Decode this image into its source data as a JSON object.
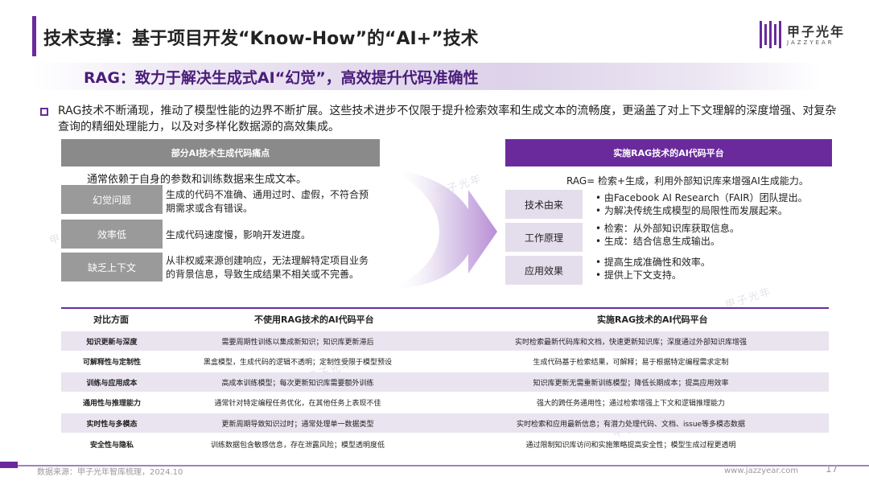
{
  "title": "技术支撑：基于项目开发“Know-How”的“AI+”技术",
  "subtitle": "RAG：致力于解决生成式AI“幻觉”，高效提升代码准确性",
  "logo": {
    "cn": "甲子光年",
    "en": "JAZZYEAR",
    "color": "#6a2a9c"
  },
  "intro": "RAG技术不断涌现，推动了模型性能的边界不断扩展。这些技术进步不仅限于提升检索效率和生成文本的流畅度，更涵盖了对上下文理解的深度增强、对复杂查询的精细处理能力，以及对多样化数据源的高效集成。",
  "left": {
    "header": "部分AI技术生成代码痛点",
    "subtitle": "通常依赖于自身的参数和训练数据来生成文本。",
    "items": [
      {
        "label": "幻觉问题",
        "desc": "生成的代码不准确、通用过时、虚假，不符合预期需求或含有错误。"
      },
      {
        "label": "效率低",
        "desc": "生成代码速度慢，影响开发进度。"
      },
      {
        "label": "缺乏上下文",
        "desc": "从非权威来源创建响应，无法理解特定项目业务的背景信息，导致生成结果不相关或不完善。"
      }
    ]
  },
  "right": {
    "header": "实施RAG技术的AI代码平台",
    "subtitle": "RAG= 检索+生成，利用外部知识库来增强AI生成能力。",
    "items": [
      {
        "label": "技术由来",
        "lines": [
          "由Facebook AI Research（FAIR）团队提出。",
          "为解决传统生成模型的局限性而发展起来。"
        ]
      },
      {
        "label": "工作原理",
        "lines": [
          "检索：从外部知识库获取信息。",
          "生成：结合信息生成输出。"
        ]
      },
      {
        "label": "应用效果",
        "lines": [
          "提高生成准确性和效率。",
          "提供上下文支持。"
        ]
      }
    ]
  },
  "table": {
    "headers": [
      "对比方面",
      "不使用RAG技术的AI代码平台",
      "实施RAG技术的AI代码平台"
    ],
    "rows": [
      [
        "知识更新与深度",
        "需要周期性训练以集成新知识；知识库更新滞后",
        "实时检索最新代码库和文档，快速更新知识库；深度通过外部知识库增强"
      ],
      [
        "可解释性与定制性",
        "黑盒模型，生成代码的逻辑不透明；定制性受限于模型预设",
        "生成代码基于检索结果，可解释；易于根据特定编程需求定制"
      ],
      [
        "训练与应用成本",
        "高成本训练模型；每次更新知识库需要额外训练",
        "知识库更新无需重新训练模型；降低长期成本；提高应用效率"
      ],
      [
        "通用性与推理能力",
        "通常针对特定编程任务优化，在其他任务上表现不佳",
        "强大的跨任务通用性；通过检索增强上下文和逻辑推理能力"
      ],
      [
        "实时性与多模态",
        "更新周期导致知识过时；通常处理单一数据类型",
        "实时检索和应用最新信息；有潜力处理代码、文档、issue等多模态数据"
      ],
      [
        "安全性与隐私",
        "训练数据包含敏感信息，存在泄露风险；模型透明度低",
        "通过限制知识库访问和实施策略提高安全性；模型生成过程更透明"
      ]
    ]
  },
  "footer": {
    "source": "数据来源：甲子光年智库梳理，2024.10",
    "website": "www.jazzyear.com",
    "page": "17"
  },
  "colors": {
    "accent": "#6a2a9c",
    "gray_header": "#8a8a8a",
    "row_shade": "#e9e4ef"
  }
}
